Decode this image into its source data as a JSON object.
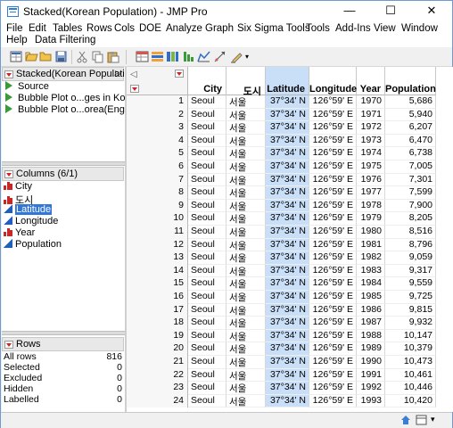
{
  "window": {
    "title": "Stacked(Korean Population) - JMP Pro",
    "controls": {
      "minimize": "—",
      "maximize": "☐",
      "close": "✕"
    }
  },
  "menu": [
    "File",
    "Edit",
    "Tables",
    "Rows",
    "Cols",
    "DOE",
    "Analyze",
    "Graph",
    "Six Sigma Tools",
    "Tools",
    "Add-Ins",
    "View",
    "Window",
    "Help",
    "Data Filtering"
  ],
  "toolbar_icons": [
    "new-table-icon",
    "open-icon",
    "open-folder-icon",
    "save-icon",
    "cut-icon",
    "copy-icon",
    "paste-icon",
    "data-table-icon",
    "rows-icon",
    "columns-icon",
    "fit-icon",
    "distribution-icon",
    "graph-builder-icon",
    "annotate-icon"
  ],
  "table_panel": {
    "title": "Stacked(Korean Populati...",
    "scripts": [
      "Source",
      "Bubble Plot o...ges in Korea",
      "Bubble Plot o...orea(English)"
    ]
  },
  "columns_panel": {
    "title": "Columns (6/1)",
    "columns": [
      {
        "name": "City",
        "type": "nominal"
      },
      {
        "name": "도시",
        "type": "nominal"
      },
      {
        "name": "Latitude",
        "type": "continuous",
        "selected": true
      },
      {
        "name": "Longitude",
        "type": "continuous"
      },
      {
        "name": "Year",
        "type": "nominal"
      },
      {
        "name": "Population",
        "type": "continuous"
      }
    ]
  },
  "rows_panel": {
    "title": "Rows",
    "stats": [
      {
        "label": "All rows",
        "value": "816"
      },
      {
        "label": "Selected",
        "value": "0"
      },
      {
        "label": "Excluded",
        "value": "0"
      },
      {
        "label": "Hidden",
        "value": "0"
      },
      {
        "label": "Labelled",
        "value": "0"
      }
    ]
  },
  "grid": {
    "headers": [
      "City",
      "도시",
      "Latitude",
      "Longitude",
      "Year",
      "Population"
    ],
    "rows": [
      [
        "1",
        "Seoul",
        "서울",
        "37°34' N",
        "126°59' E",
        "1970",
        "5,686"
      ],
      [
        "2",
        "Seoul",
        "서울",
        "37°34' N",
        "126°59' E",
        "1971",
        "5,940"
      ],
      [
        "3",
        "Seoul",
        "서울",
        "37°34' N",
        "126°59' E",
        "1972",
        "6,207"
      ],
      [
        "4",
        "Seoul",
        "서울",
        "37°34' N",
        "126°59' E",
        "1973",
        "6,470"
      ],
      [
        "5",
        "Seoul",
        "서울",
        "37°34' N",
        "126°59' E",
        "1974",
        "6,738"
      ],
      [
        "6",
        "Seoul",
        "서울",
        "37°34' N",
        "126°59' E",
        "1975",
        "7,005"
      ],
      [
        "7",
        "Seoul",
        "서울",
        "37°34' N",
        "126°59' E",
        "1976",
        "7,301"
      ],
      [
        "8",
        "Seoul",
        "서울",
        "37°34' N",
        "126°59' E",
        "1977",
        "7,599"
      ],
      [
        "9",
        "Seoul",
        "서울",
        "37°34' N",
        "126°59' E",
        "1978",
        "7,900"
      ],
      [
        "10",
        "Seoul",
        "서울",
        "37°34' N",
        "126°59' E",
        "1979",
        "8,205"
      ],
      [
        "11",
        "Seoul",
        "서울",
        "37°34' N",
        "126°59' E",
        "1980",
        "8,516"
      ],
      [
        "12",
        "Seoul",
        "서울",
        "37°34' N",
        "126°59' E",
        "1981",
        "8,796"
      ],
      [
        "13",
        "Seoul",
        "서울",
        "37°34' N",
        "126°59' E",
        "1982",
        "9,059"
      ],
      [
        "14",
        "Seoul",
        "서울",
        "37°34' N",
        "126°59' E",
        "1983",
        "9,317"
      ],
      [
        "15",
        "Seoul",
        "서울",
        "37°34' N",
        "126°59' E",
        "1984",
        "9,559"
      ],
      [
        "16",
        "Seoul",
        "서울",
        "37°34' N",
        "126°59' E",
        "1985",
        "9,725"
      ],
      [
        "17",
        "Seoul",
        "서울",
        "37°34' N",
        "126°59' E",
        "1986",
        "9,815"
      ],
      [
        "18",
        "Seoul",
        "서울",
        "37°34' N",
        "126°59' E",
        "1987",
        "9,932"
      ],
      [
        "19",
        "Seoul",
        "서울",
        "37°34' N",
        "126°59' E",
        "1988",
        "10,147"
      ],
      [
        "20",
        "Seoul",
        "서울",
        "37°34' N",
        "126°59' E",
        "1989",
        "10,379"
      ],
      [
        "21",
        "Seoul",
        "서울",
        "37°34' N",
        "126°59' E",
        "1990",
        "10,473"
      ],
      [
        "22",
        "Seoul",
        "서울",
        "37°34' N",
        "126°59' E",
        "1991",
        "10,461"
      ],
      [
        "23",
        "Seoul",
        "서울",
        "37°34' N",
        "126°59' E",
        "1992",
        "10,446"
      ],
      [
        "24",
        "Seoul",
        "서울",
        "37°34' N",
        "126°59' E",
        "1993",
        "10,420"
      ]
    ]
  },
  "status_icons": [
    "home-icon",
    "window-list-icon",
    "dropdown-icon"
  ]
}
